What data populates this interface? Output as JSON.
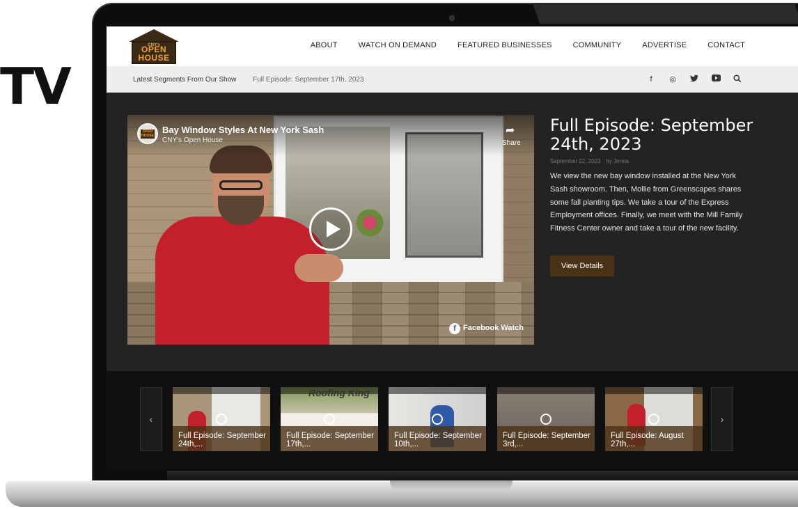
{
  "side_label": "TV",
  "logo": {
    "small_text": "CNY's",
    "main_text": "OPEN HOUSE"
  },
  "nav": [
    "ABOUT",
    "WATCH ON DEMAND",
    "FEATURED BUSINESSES",
    "COMMUNITY",
    "ADVERTISE",
    "CONTACT"
  ],
  "subbar": {
    "latest_label": "Latest Segments From Our Show",
    "current_segment": "Full Episode: September 17th, 2023",
    "social_icons": [
      "facebook-icon",
      "instagram-icon",
      "twitter-icon",
      "youtube-icon",
      "search-icon"
    ],
    "social_glyphs": [
      "f",
      "◎",
      "🐦",
      "▶",
      "⌕"
    ]
  },
  "video": {
    "title": "Bay Window Styles At New York Sash",
    "channel": "CNY's Open House",
    "share_label": "Share",
    "watermark": "Facebook Watch",
    "avatar_text": "OPEN HOUSE"
  },
  "episode": {
    "title": "Full Episode: September 24th, 2023",
    "date": "September 22, 2023",
    "author": "by Jenna",
    "description": "We view the new bay window installed at the New York Sash showroom. Then, Mollie from Greenscapes shares some fall planting tips. We take a tour of the Express Employment offices. Finally, we meet with the Mill Family Fitness Center owner and take a tour of the new facility.",
    "button_label": "View Details"
  },
  "carousel": {
    "prev_glyph": "‹",
    "next_glyph": "›",
    "items": [
      {
        "label": "Full Episode: September 24th,..."
      },
      {
        "label": "Full Episode: September 17th,..."
      },
      {
        "label": "Full Episode: September 10th,..."
      },
      {
        "label": "Full Episode: September 3rd,..."
      },
      {
        "label": "Full Episode: August 27th,..."
      }
    ],
    "thumb2_sign": "Roofing King"
  },
  "colors": {
    "accent_brown": "#4a3217",
    "screen_bg": "#232323",
    "logo_orange": "#f2a12a"
  }
}
